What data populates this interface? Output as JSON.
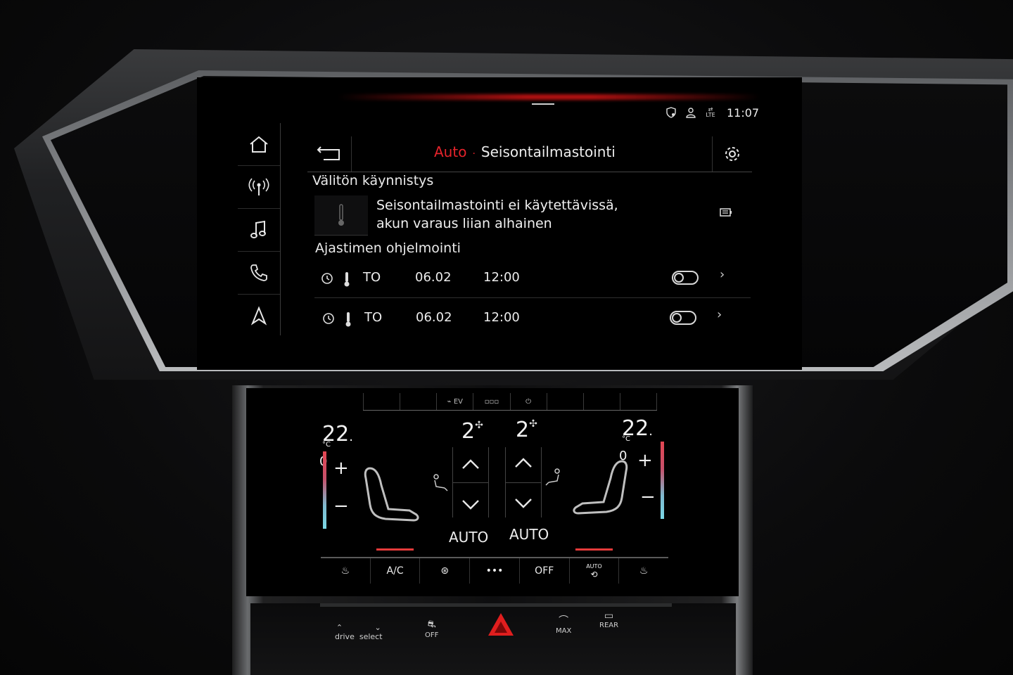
{
  "status_bar": {
    "time": "11:07",
    "network_label": "LTE"
  },
  "sidebar": {
    "items": [
      "home",
      "radio",
      "media",
      "phone",
      "navigation"
    ]
  },
  "header": {
    "breadcrumb": "Auto",
    "separator": "·",
    "title": "Seisontailmastointi"
  },
  "immediate_start": {
    "heading": "Välitön käynnistys",
    "message_line1": "Seisontailmastointi ei käytettävissä,",
    "message_line2": "akun varaus liian alhainen"
  },
  "timer_programming": {
    "heading": "Ajastimen ohjelmointi",
    "rows": [
      {
        "day": "TO",
        "date": "06.02",
        "time": "12:00",
        "enabled": false
      },
      {
        "day": "TO",
        "date": "06.02",
        "time": "12:00",
        "enabled": false
      }
    ]
  },
  "climate": {
    "modes": [
      "",
      "",
      "EV",
      "",
      "",
      "",
      "",
      ""
    ],
    "left": {
      "temp_int": "22",
      "temp_dec": "0",
      "unit": "°C",
      "fan": "2",
      "mode": "AUTO"
    },
    "right": {
      "temp_int": "22",
      "temp_dec": "0",
      "unit": "°C",
      "fan": "2",
      "mode": "AUTO"
    },
    "plus": "+",
    "minus": "−",
    "bottom_tabs": [
      "",
      "A/C",
      "",
      "•••",
      "OFF",
      "AUTO",
      ""
    ]
  },
  "physical_buttons": {
    "drive_label": "drive",
    "select_label": "select",
    "esc_off_label": "OFF",
    "defrost_max_label": "MAX",
    "rear_label": "REAR"
  },
  "colors": {
    "accent": "#e5232b",
    "text": "#ececec",
    "background": "#000000"
  }
}
